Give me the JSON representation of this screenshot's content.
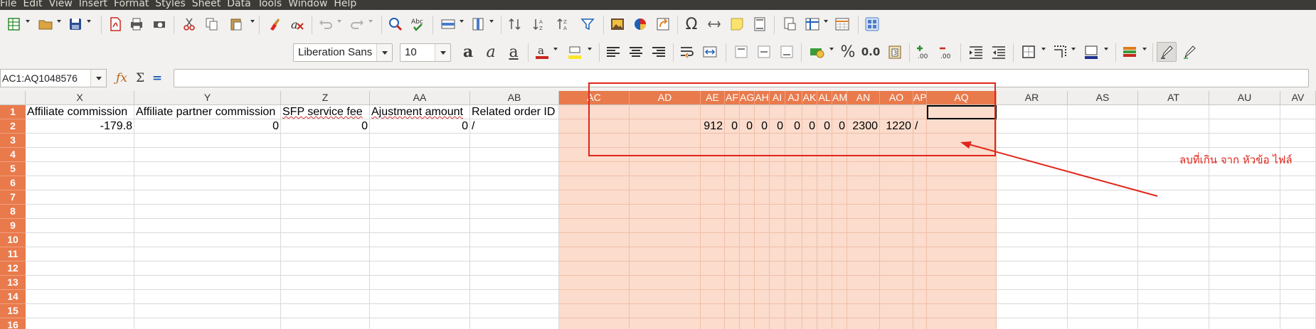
{
  "menu": [
    "File",
    "Edit",
    "View",
    "Insert",
    "Format",
    "Styles",
    "Sheet",
    "Data",
    "Tools",
    "Window",
    "Help"
  ],
  "toolbar2": {
    "font_name": "Liberation Sans",
    "font_size": "10",
    "percent_label": "%",
    "decimal_label": "0.0"
  },
  "formula_bar": {
    "name_box": "AC1:AQ1048576",
    "formula_value": ""
  },
  "sheet": {
    "columns": [
      "X",
      "Y",
      "Z",
      "AA",
      "AB",
      "AC",
      "AD",
      "AE",
      "AF",
      "AG",
      "AH",
      "AI",
      "AJ",
      "AK",
      "AL",
      "AM",
      "AN",
      "AO",
      "AP",
      "AQ",
      "AR",
      "AS",
      "AT",
      "AU",
      "AV"
    ],
    "row_numbers": [
      "1",
      "2",
      "3",
      "4",
      "5",
      "6",
      "7",
      "8",
      "9",
      "10",
      "11",
      "12",
      "13",
      "14",
      "15",
      "16"
    ],
    "row1": {
      "X": "Affiliate commission",
      "Y": "Affiliate partner commission",
      "Z": "SFP service fee",
      "AA": "Ajustment amount",
      "AB": "Related order ID"
    },
    "row2": {
      "X": "-179.8",
      "Y": "0",
      "Z": "0",
      "AA": "0",
      "AB": "/",
      "AE": "912",
      "AF": "0",
      "AG": "0",
      "AH": "0",
      "AI": "0",
      "AJ": "0",
      "AK": "0",
      "AL": "0",
      "AM": "0",
      "AN": "2300",
      "AO": "1220",
      "AP": "/"
    }
  },
  "annotation": {
    "text": "ลบที่เกิน จาก หัวข้อ ไฟล์",
    "color": "#e0261c"
  },
  "colors": {
    "selection_header": "#e97a4c",
    "selection_fill": "#fbdccd",
    "menubar": "#3c3b37"
  }
}
